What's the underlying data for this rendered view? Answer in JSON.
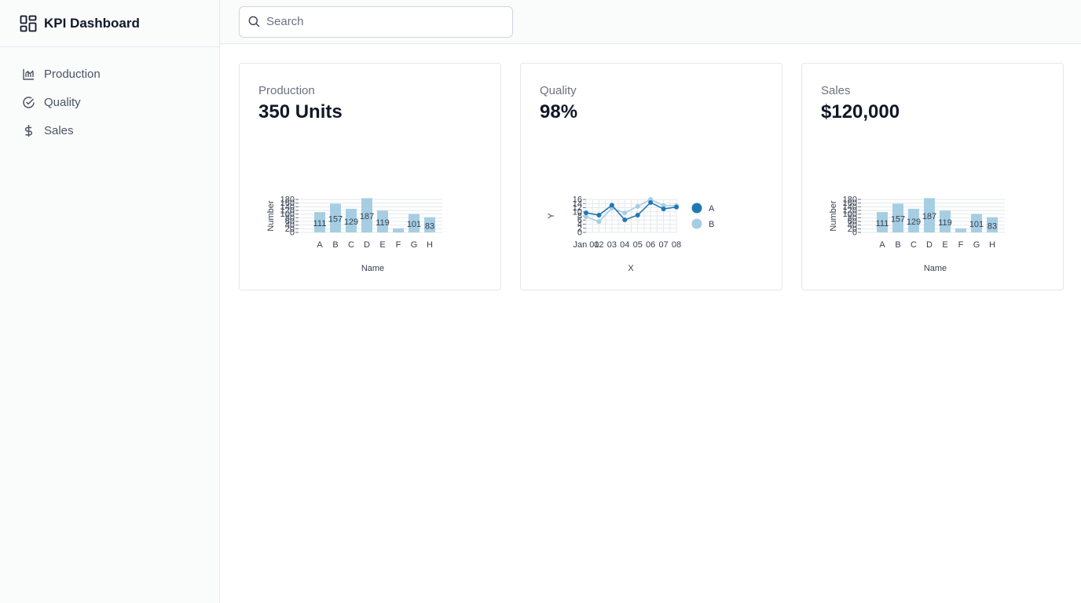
{
  "app": {
    "title": "KPI Dashboard"
  },
  "sidebar": {
    "items": [
      {
        "label": "Production",
        "icon": "chart-icon"
      },
      {
        "label": "Quality",
        "icon": "check-circle-icon"
      },
      {
        "label": "Sales",
        "icon": "dollar-icon"
      }
    ]
  },
  "search": {
    "placeholder": "Search",
    "value": ""
  },
  "colors": {
    "bar": "#a6cee3",
    "series_a": "#1f78b4",
    "series_b": "#a6cee3",
    "grid": "#e5e7eb"
  },
  "cards": [
    {
      "label": "Production",
      "value": "350 Units",
      "chart_data": {
        "type": "bar",
        "categories": [
          "A",
          "B",
          "C",
          "D",
          "E",
          "F",
          "G",
          "H"
        ],
        "values": [
          111,
          157,
          129,
          187,
          119,
          22,
          101,
          83
        ],
        "data_labels": [
          "111",
          "157",
          "129",
          "187",
          "119",
          "",
          "101",
          "83"
        ],
        "xlabel": "Name",
        "ylabel": "Number",
        "ylim": [
          0,
          180
        ],
        "yticks": [
          "0",
          "20",
          "40",
          "60",
          "80",
          "100",
          "120",
          "140",
          "160",
          "180"
        ]
      }
    },
    {
      "label": "Quality",
      "value": "98%",
      "chart_data": {
        "type": "line",
        "x": [
          "Jan 01",
          "02",
          "03",
          "04",
          "05",
          "06",
          "07",
          "08"
        ],
        "xtick_labels": [
          "Jan 01",
          "02",
          "03",
          "04",
          "05",
          "06",
          "07",
          "08"
        ],
        "series": [
          {
            "name": "A",
            "values": [
              9.5,
              8.4,
              13.2,
              6.1,
              8.4,
              14.5,
              11.4,
              12.3
            ]
          },
          {
            "name": "B",
            "values": [
              7.6,
              5.3,
              11.8,
              9.5,
              12.6,
              16.0,
              13.0,
              13.0
            ]
          }
        ],
        "xlabel": "X",
        "ylabel": "Y",
        "ylim": [
          0,
          16
        ],
        "yticks": [
          "0",
          "2",
          "4",
          "6",
          "8",
          "10",
          "12",
          "14",
          "16"
        ],
        "legend": "right"
      }
    },
    {
      "label": "Sales",
      "value": "$120,000",
      "chart_data": {
        "type": "bar",
        "categories": [
          "A",
          "B",
          "C",
          "D",
          "E",
          "F",
          "G",
          "H"
        ],
        "values": [
          111,
          157,
          129,
          187,
          119,
          22,
          101,
          83
        ],
        "data_labels": [
          "111",
          "157",
          "129",
          "187",
          "119",
          "",
          "101",
          "83"
        ],
        "xlabel": "Name",
        "ylabel": "Number",
        "ylim": [
          0,
          180
        ],
        "yticks": [
          "0",
          "20",
          "40",
          "60",
          "80",
          "100",
          "120",
          "140",
          "160",
          "180"
        ]
      }
    }
  ]
}
